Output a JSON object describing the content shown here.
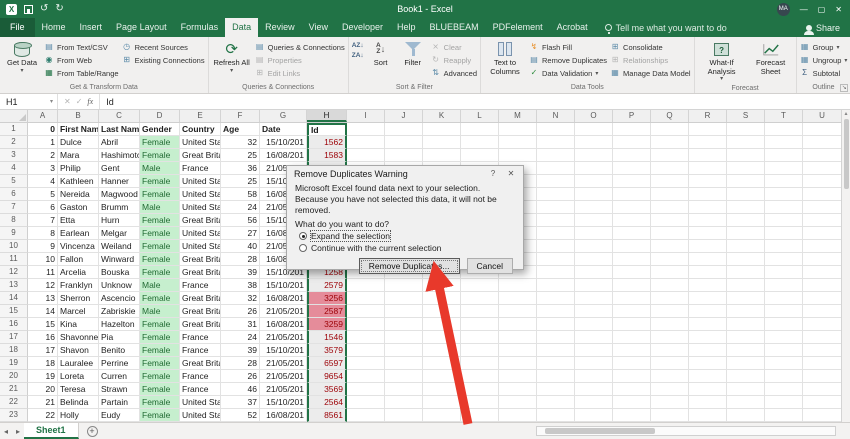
{
  "title_bar": {
    "title": "Book1 - Excel",
    "avatar": "MA"
  },
  "icons": {
    "minimize": "—",
    "maximize": "▢",
    "close": "✕",
    "undo": "↺",
    "redo": "↻",
    "dropdown": "▾",
    "refresh": "⟳",
    "cancel_glyph": "✕",
    "enter_glyph": "✓",
    "doc": "▤",
    "table": "▦",
    "grid": "⊞",
    "globe": "◉",
    "clock": "◷",
    "flash": "↯",
    "check": "✓",
    "sigma": "Σ",
    "clear": "⨯",
    "reapply": "↻",
    "advanced": "⇅",
    "sort_az": "AZ↓",
    "sort_za": "ZA↓",
    "sheet_prev": "◂",
    "sheet_next": "▸",
    "add_sheet": "+",
    "scroll_up": "▴",
    "dialog_launcher": "↘",
    "help": "?"
  },
  "tabs": [
    {
      "label": "File",
      "type": "file"
    },
    {
      "label": "Home"
    },
    {
      "label": "Insert"
    },
    {
      "label": "Page Layout"
    },
    {
      "label": "Formulas"
    },
    {
      "label": "Data",
      "active": true
    },
    {
      "label": "Review"
    },
    {
      "label": "View"
    },
    {
      "label": "Developer"
    },
    {
      "label": "Help"
    },
    {
      "label": "BLUEBEAM"
    },
    {
      "label": "PDFelement"
    },
    {
      "label": "Acrobat"
    }
  ],
  "tell_me": "Tell me what you want to do",
  "share": "Share",
  "ribbon": {
    "get_data": "Get Data",
    "from_text_csv": "From Text/CSV",
    "from_web": "From Web",
    "from_table_range": "From Table/Range",
    "recent_sources": "Recent Sources",
    "existing_connections": "Existing Connections",
    "refresh_all": "Refresh All",
    "queries_connections": "Queries & Connections",
    "properties": "Properties",
    "edit_links": "Edit Links",
    "sort": "Sort",
    "filter": "Filter",
    "clear": "Clear",
    "reapply": "Reapply",
    "advanced": "Advanced",
    "text_to_columns": "Text to Columns",
    "flash_fill": "Flash Fill",
    "remove_duplicates": "Remove Duplicates",
    "data_validation": "Data Validation",
    "consolidate": "Consolidate",
    "relationships": "Relationships",
    "manage_data_model": "Manage Data Model",
    "what_if_analysis": "What-If Analysis",
    "forecast_sheet": "Forecast Sheet",
    "group": "Group",
    "ungroup": "Ungroup",
    "subtotal": "Subtotal",
    "group_labels": {
      "g1": "Get & Transform Data",
      "g2": "Queries & Connections",
      "g3": "Sort & Filter",
      "g4": "Data Tools",
      "g5": "Forecast",
      "g6": "Outline"
    }
  },
  "formula_bar": {
    "name_box": "H1",
    "fx": "fx",
    "value": "Id"
  },
  "grid": {
    "columns": [
      "A",
      "B",
      "C",
      "D",
      "E",
      "F",
      "G",
      "H",
      "I",
      "J",
      "K",
      "L",
      "M",
      "N",
      "O",
      "P",
      "Q",
      "R",
      "S",
      "T",
      "U"
    ],
    "selected_column": "H",
    "active_cell": "H1",
    "rows": [
      {
        "n": "1",
        "cells": [
          "0",
          "First Nam",
          "Last Nam",
          "Gender",
          "Country",
          "Age",
          "Date",
          "Id"
        ]
      },
      {
        "n": "2",
        "cells": [
          "1",
          "Dulce",
          "Abril",
          "Female",
          "United Sta",
          "32",
          "15/10/201",
          "1562"
        ]
      },
      {
        "n": "3",
        "cells": [
          "2",
          "Mara",
          "Hashimoto",
          "Female",
          "Great Brita",
          "25",
          "16/08/201",
          "1583"
        ]
      },
      {
        "n": "4",
        "cells": [
          "3",
          "Philip",
          "Gent",
          "Male",
          "France",
          "36",
          "21/05/201",
          ""
        ]
      },
      {
        "n": "5",
        "cells": [
          "4",
          "Kathleen",
          "Hanner",
          "Female",
          "United Sta",
          "25",
          "15/10/201",
          ""
        ]
      },
      {
        "n": "6",
        "cells": [
          "5",
          "Nereida",
          "Magwood",
          "Female",
          "United Sta",
          "58",
          "16/08/201",
          ""
        ]
      },
      {
        "n": "7",
        "cells": [
          "6",
          "Gaston",
          "Brumm",
          "Male",
          "United Sta",
          "24",
          "21/05/201",
          ""
        ]
      },
      {
        "n": "8",
        "cells": [
          "7",
          "Etta",
          "Hurn",
          "Female",
          "Great Brita",
          "56",
          "15/10/201",
          ""
        ]
      },
      {
        "n": "9",
        "cells": [
          "8",
          "Earlean",
          "Melgar",
          "Female",
          "United Sta",
          "27",
          "16/08/201",
          ""
        ]
      },
      {
        "n": "10",
        "cells": [
          "9",
          "Vincenza",
          "Weiland",
          "Female",
          "United Sta",
          "40",
          "21/05/201",
          ""
        ]
      },
      {
        "n": "11",
        "cells": [
          "10",
          "Fallon",
          "Winward",
          "Female",
          "Great Brita",
          "28",
          "16/08/201",
          ""
        ]
      },
      {
        "n": "12",
        "cells": [
          "11",
          "Arcelia",
          "Bouska",
          "Female",
          "Great Brita",
          "39",
          "15/10/201",
          "1258"
        ]
      },
      {
        "n": "13",
        "cells": [
          "12",
          "Franklyn",
          "Unknow",
          "Male",
          "France",
          "38",
          "15/10/201",
          "2579"
        ]
      },
      {
        "n": "14",
        "cells": [
          "13",
          "Sherron",
          "Ascencio",
          "Female",
          "Great Brita",
          "32",
          "16/08/201",
          "3256"
        ],
        "dup": true
      },
      {
        "n": "15",
        "cells": [
          "14",
          "Marcel",
          "Zabriskie",
          "Male",
          "Great Brita",
          "26",
          "21/05/201",
          "2587"
        ],
        "dup": true
      },
      {
        "n": "16",
        "cells": [
          "15",
          "Kina",
          "Hazelton",
          "Female",
          "Great Brita",
          "31",
          "16/08/201",
          "3259"
        ],
        "dup": true
      },
      {
        "n": "17",
        "cells": [
          "16",
          "Shavonne",
          "Pia",
          "Female",
          "France",
          "24",
          "21/05/201",
          "1546"
        ]
      },
      {
        "n": "18",
        "cells": [
          "17",
          "Shavon",
          "Benito",
          "Female",
          "France",
          "39",
          "15/10/201",
          "3579"
        ]
      },
      {
        "n": "19",
        "cells": [
          "18",
          "Lauralee",
          "Perrine",
          "Female",
          "Great Brita",
          "28",
          "21/05/201",
          "6597"
        ]
      },
      {
        "n": "20",
        "cells": [
          "19",
          "Loreta",
          "Curren",
          "Female",
          "France",
          "26",
          "21/05/201",
          "9654"
        ]
      },
      {
        "n": "21",
        "cells": [
          "20",
          "Teresa",
          "Strawn",
          "Female",
          "France",
          "46",
          "21/05/201",
          "3569"
        ]
      },
      {
        "n": "22",
        "cells": [
          "21",
          "Belinda",
          "Partain",
          "Female",
          "United Sta",
          "37",
          "15/10/201",
          "2564"
        ]
      },
      {
        "n": "23",
        "cells": [
          "22",
          "Holly",
          "Eudy",
          "Female",
          "United Sta",
          "52",
          "16/08/201",
          "8561"
        ]
      }
    ]
  },
  "dialog": {
    "title": "Remove Duplicates Warning",
    "help": "?",
    "close": "✕",
    "message": "Microsoft Excel found data next to your selection. Because you have not selected this data, it will not be removed.",
    "question": "What do you want to do?",
    "options": [
      {
        "label": "Expand the selection",
        "selected": true
      },
      {
        "label": "Continue with the current selection",
        "selected": false
      }
    ],
    "buttons": [
      {
        "label": "Remove Duplicates...",
        "default": true
      },
      {
        "label": "Cancel"
      }
    ]
  },
  "sheet": {
    "active": "Sheet1"
  },
  "colors": {
    "accent": "#217346",
    "gender_bg": "#c6efce",
    "duplicate_bg": "#e58c9a",
    "duplicate_text": "#9c0006",
    "arrow": "#e8392b"
  }
}
